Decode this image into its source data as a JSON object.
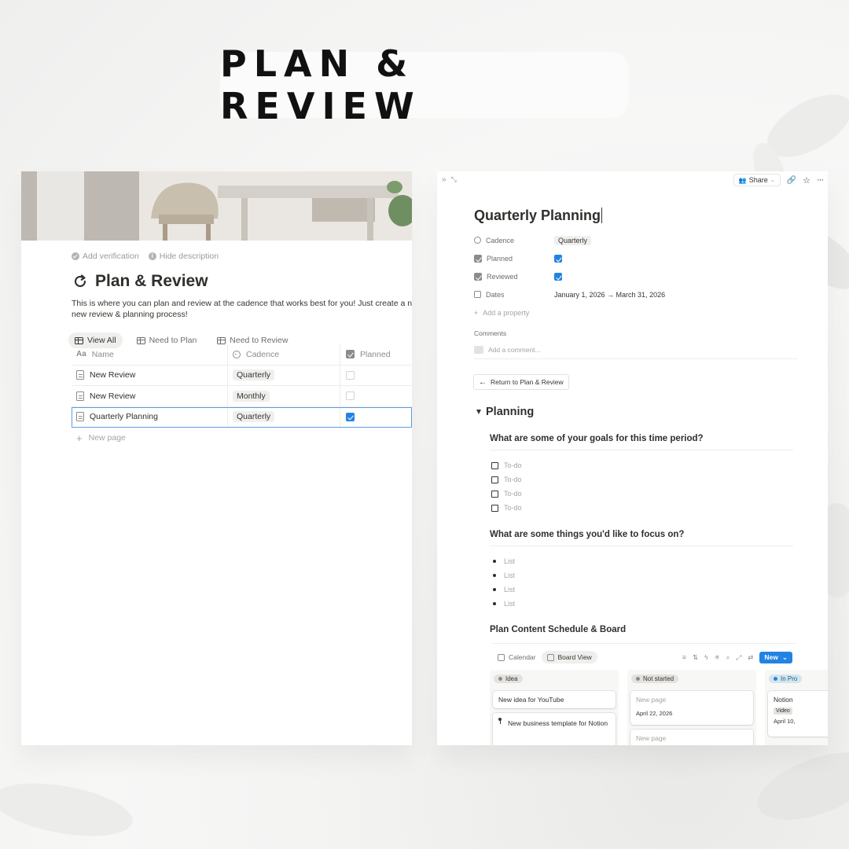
{
  "banner": {
    "title": "PLAN & REVIEW"
  },
  "left": {
    "meta": {
      "verify": "Add verification",
      "hide": "Hide description"
    },
    "title": "Plan & Review",
    "description_line1": "This is where you can plan and review at the cadence that works best for you! Just create a ne",
    "description_line2": "new review & planning process!",
    "tabs": [
      "View All",
      "Need to Plan",
      "Need to Review"
    ],
    "columns": [
      "Name",
      "Cadence",
      "Planned"
    ],
    "rows": [
      {
        "name": "New Review",
        "cadence": "Quarterly",
        "planned": false
      },
      {
        "name": "New Review",
        "cadence": "Monthly",
        "planned": false
      },
      {
        "name": "Quarterly Planning",
        "cadence": "Quarterly",
        "planned": true
      }
    ],
    "new_page": "New page"
  },
  "right": {
    "topbar": {
      "share": "Share"
    },
    "title": "Quarterly Planning",
    "properties": {
      "cadence_label": "Cadence",
      "cadence_value": "Quarterly",
      "planned_label": "Planned",
      "planned_value": true,
      "reviewed_label": "Reviewed",
      "reviewed_value": true,
      "dates_label": "Dates",
      "dates_value": "January 1, 2026 → March 31, 2026",
      "add": "Add a property"
    },
    "comments": {
      "label": "Comments",
      "placeholder": "Add a comment..."
    },
    "return_button": "Return to Plan & Review",
    "section": "Planning",
    "q1": "What are some of your goals for this time period?",
    "todos": [
      "To-do",
      "To-do",
      "To-do",
      "To-do"
    ],
    "q2": "What are some things you'd like to focus on?",
    "list": [
      "List",
      "List",
      "List",
      "List"
    ],
    "schedule_heading": "Plan Content Schedule & Board",
    "views": [
      "Calendar",
      "Board View"
    ],
    "new_button": "New",
    "board": {
      "col1": {
        "status": "Idea",
        "card1": "New idea for YouTube",
        "card2": "New business template for Notion"
      },
      "col2": {
        "status": "Not started",
        "card1": "New page",
        "card1_date": "April 22, 2026",
        "card2": "New page"
      },
      "col3": {
        "status": "In Pro",
        "card1": "Notion",
        "card1_tag": "Video",
        "card1_date": "April 10,"
      }
    }
  },
  "colors": {
    "accent": "#2383e2",
    "text": "#37352f",
    "muted": "#9b9a97"
  }
}
